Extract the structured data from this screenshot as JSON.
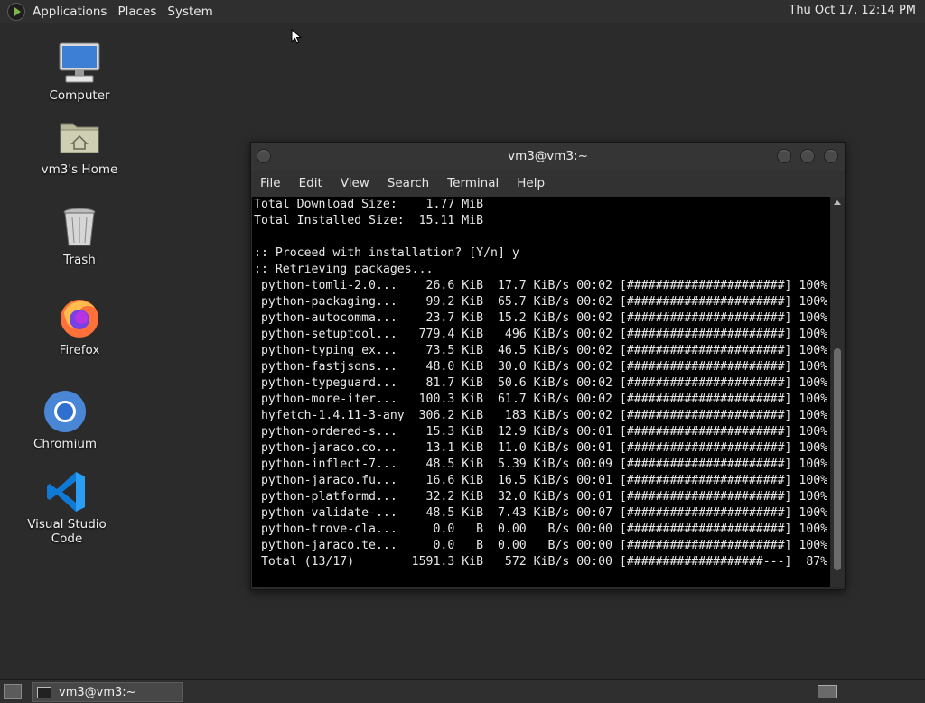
{
  "top_panel": {
    "menus": [
      "Applications",
      "Places",
      "System"
    ],
    "clock": "Thu Oct 17, 12:14 PM"
  },
  "desktop_icons": [
    {
      "label": "Computer",
      "icon": "computer-icon"
    },
    {
      "label": "vm3's Home",
      "icon": "home-folder-icon"
    },
    {
      "label": "Trash",
      "icon": "trash-icon"
    },
    {
      "label": "Firefox",
      "icon": "firefox-icon"
    },
    {
      "label": "Chromium",
      "icon": "chromium-icon"
    },
    {
      "label": "Visual Studio Code",
      "icon": "vscode-icon"
    }
  ],
  "terminal": {
    "title": "vm3@vm3:~",
    "menu": [
      "File",
      "Edit",
      "View",
      "Search",
      "Terminal",
      "Help"
    ],
    "lines": [
      "Total Download Size:    1.77 MiB",
      "Total Installed Size:  15.11 MiB",
      "",
      ":: Proceed with installation? [Y/n] y",
      ":: Retrieving packages...",
      " python-tomli-2.0...    26.6 KiB  17.7 KiB/s 00:02 [######################] 100%",
      " python-packaging...    99.2 KiB  65.7 KiB/s 00:02 [######################] 100%",
      " python-autocomma...    23.7 KiB  15.2 KiB/s 00:02 [######################] 100%",
      " python-setuptool...   779.4 KiB   496 KiB/s 00:02 [######################] 100%",
      " python-typing_ex...    73.5 KiB  46.5 KiB/s 00:02 [######################] 100%",
      " python-fastjsons...    48.0 KiB  30.0 KiB/s 00:02 [######################] 100%",
      " python-typeguard...    81.7 KiB  50.6 KiB/s 00:02 [######################] 100%",
      " python-more-iter...   100.3 KiB  61.7 KiB/s 00:02 [######################] 100%",
      " hyfetch-1.4.11-3-any  306.2 KiB   183 KiB/s 00:02 [######################] 100%",
      " python-ordered-s...    15.3 KiB  12.9 KiB/s 00:01 [######################] 100%",
      " python-jaraco.co...    13.1 KiB  11.0 KiB/s 00:01 [######################] 100%",
      " python-inflect-7...    48.5 KiB  5.39 KiB/s 00:09 [######################] 100%",
      " python-jaraco.fu...    16.6 KiB  16.5 KiB/s 00:01 [######################] 100%",
      " python-platformd...    32.2 KiB  32.0 KiB/s 00:01 [######################] 100%",
      " python-validate-...    48.5 KiB  7.43 KiB/s 00:07 [######################] 100%",
      " python-trove-cla...     0.0   B  0.00   B/s 00:00 [######################] 100%",
      " python-jaraco.te...     0.0   B  0.00   B/s 00:00 [######################] 100%",
      " Total (13/17)        1591.3 KiB   572 KiB/s 00:00 [###################---]  87%"
    ]
  },
  "taskbar": {
    "task_label": "vm3@vm3:~"
  }
}
